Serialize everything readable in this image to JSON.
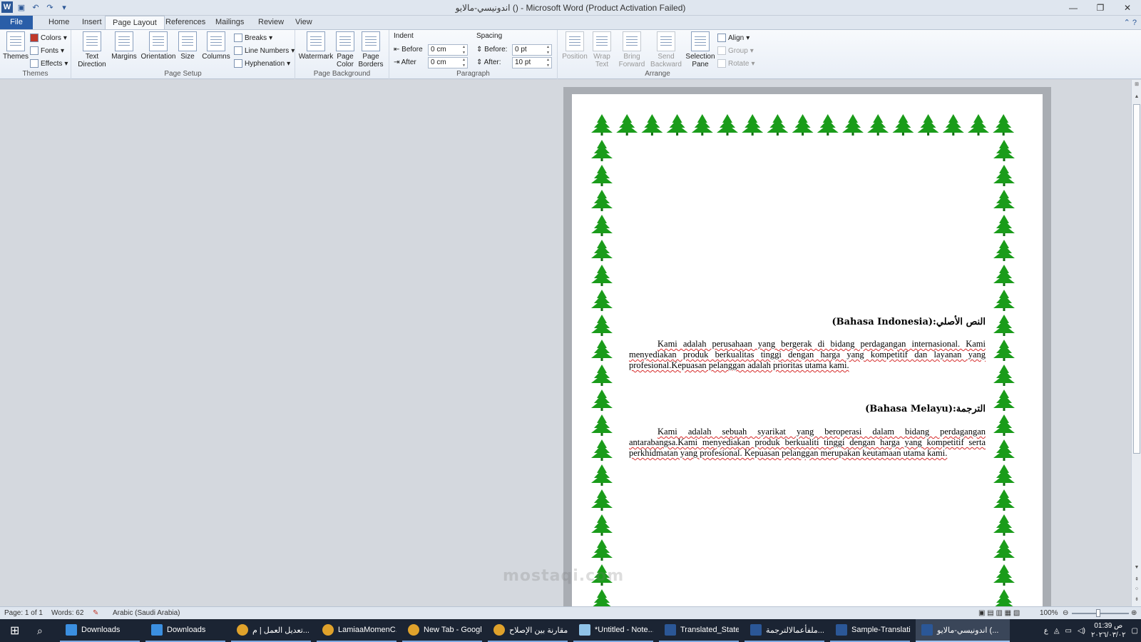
{
  "window": {
    "title": "اندونيسي-مالايو ()  -  Microsoft Word (Product Activation Failed)",
    "controls": [
      "—",
      "❐",
      "✕"
    ]
  },
  "tabs": [
    "File",
    "Home",
    "Insert",
    "Page Layout",
    "References",
    "Mailings",
    "Review",
    "View"
  ],
  "active_tab": "Page Layout",
  "ribbon": {
    "themes": {
      "themes_btn": "Themes",
      "colors": "Colors",
      "fonts": "Fonts",
      "effects": "Effects",
      "label": "Themes"
    },
    "page_setup": {
      "text_direction": "Text Direction",
      "margins": "Margins",
      "orientation": "Orientation",
      "size": "Size",
      "columns": "Columns",
      "breaks": "Breaks",
      "line_numbers": "Line Numbers",
      "hyphenation": "Hyphenation",
      "label": "Page Setup"
    },
    "page_background": {
      "watermark": "Watermark",
      "page_color": "Page Color",
      "page_borders": "Page Borders",
      "label": "Page Background"
    },
    "paragraph": {
      "indent_label": "Indent",
      "indent_before_label": "Before",
      "indent_before_value": "0 cm",
      "indent_after_label": "After",
      "indent_after_value": "0 cm",
      "spacing_label": "Spacing",
      "spacing_before_label": "Before:",
      "spacing_before_value": "0 pt",
      "spacing_after_label": "After:",
      "spacing_after_value": "10 pt",
      "label": "Paragraph"
    },
    "arrange": {
      "position": "Position",
      "wrap_text": "Wrap Text",
      "bring_forward": "Bring Forward",
      "send_backward": "Send Backward",
      "selection_pane": "Selection Pane",
      "align": "Align",
      "group": "Group",
      "rotate": "Rotate",
      "label": "Arrange"
    }
  },
  "document": {
    "heading1": "النص الأصلي:(Bahasa Indonesia)",
    "paragraph1": "Kami adalah perusahaan yang bergerak di bidang perdagangan internasional. Kami menyediakan produk berkualitas tinggi dengan harga yang kompetitif dan layanan yang profesional.Kepuasan pelanggan adalah prioritas utama kami.",
    "heading2": "الترجمة:(Bahasa Melayu)",
    "paragraph2": "Kami adalah sebuah syarikat yang beroperasi dalam bidang perdagangan antarabangsa.Kami menyediakan produk berkualiti tinggi dengan harga yang kompetitif serta perkhidmatan yang profesional. Kepuasan pelanggan merupakan keutamaan utama kami.",
    "border_color": "#1a9c1a"
  },
  "statusbar": {
    "page": "Page: 1 of 1",
    "words": "Words: 62",
    "language": "Arabic (Saudi Arabia)",
    "zoom": "100%"
  },
  "taskbar": {
    "items": [
      {
        "label": "Downloads",
        "icon": "download-icon",
        "color": "#3b8fe0"
      },
      {
        "label": "Downloads",
        "icon": "download-icon",
        "color": "#3b8fe0"
      },
      {
        "label": "تعديل العمل | م...",
        "icon": "chrome-icon",
        "color": "#e0a22b"
      },
      {
        "label": "LamiaaMomenC...",
        "icon": "chrome-icon",
        "color": "#e0a22b"
      },
      {
        "label": "New Tab - Googl...",
        "icon": "chrome-icon",
        "color": "#e0a22b"
      },
      {
        "label": "مقارنة بين الإصلاح...",
        "icon": "chrome-icon",
        "color": "#e0a22b"
      },
      {
        "label": "*Untitled - Note...",
        "icon": "notepad-icon",
        "color": "#8fc3e8"
      },
      {
        "label": "Translated_State...",
        "icon": "word-icon",
        "color": "#2b5797"
      },
      {
        "label": "ملفأعمالالترجمة...",
        "icon": "word-icon",
        "color": "#2b5797"
      },
      {
        "label": "Sample-Translati...",
        "icon": "word-icon",
        "color": "#2b5797"
      },
      {
        "label": "اندونيسي-مالايو (...",
        "icon": "word-icon",
        "color": "#2b5797"
      }
    ],
    "clock_time": "01:39 ص",
    "clock_date": "٢٠٢٦/٠٣/٠٢",
    "lang": "ع"
  },
  "watermark": "mostaqi.com"
}
